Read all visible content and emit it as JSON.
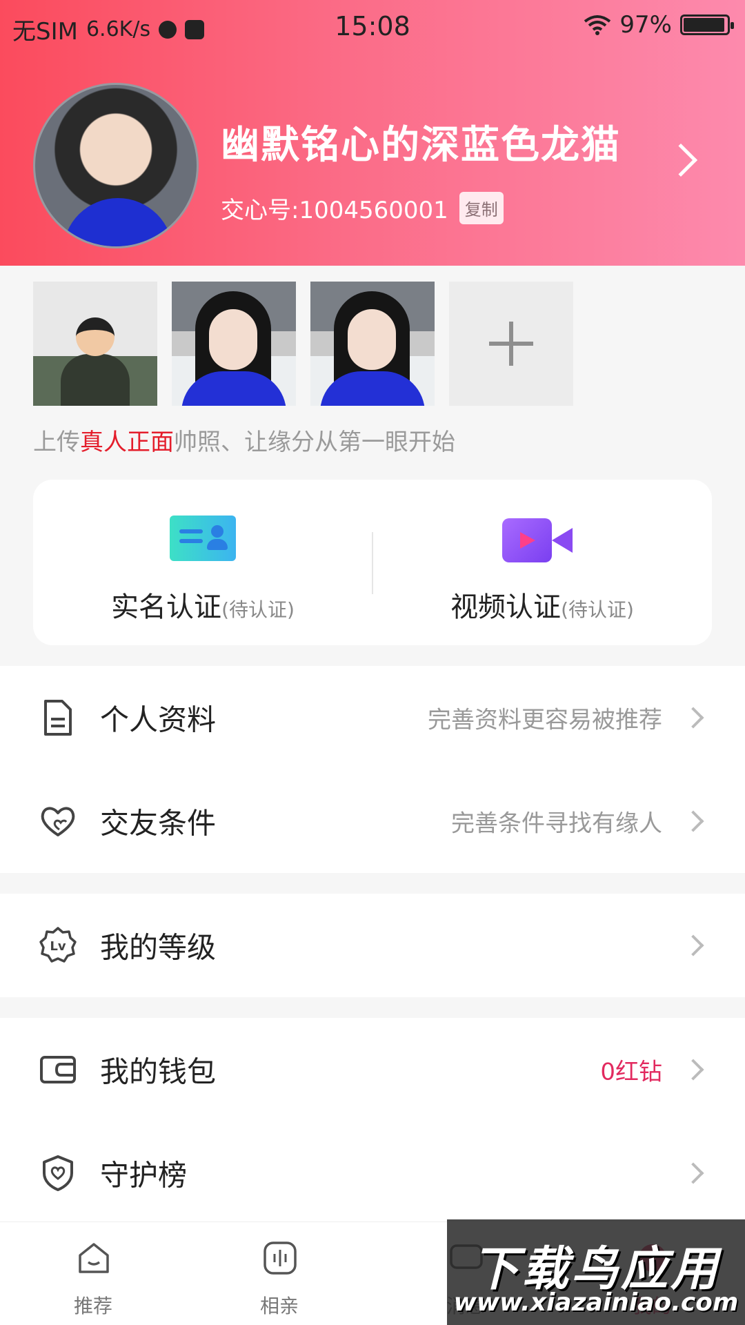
{
  "status_bar": {
    "carrier": "无SIM",
    "speed": "6.6K/s",
    "time": "15:08",
    "battery": "97%"
  },
  "profile": {
    "name": "幽默铭心的深蓝色龙猫",
    "id_text": "交心号:1004560001",
    "copy_label": "复制"
  },
  "photos": {
    "hint_pre": "上传",
    "hint_em": "真人正面",
    "hint_post": "帅照、让缘分从第一眼开始"
  },
  "verify": {
    "realname_label": "实名认证",
    "realname_status": "(待认证)",
    "video_label": "视频认证",
    "video_status": "(待认证)"
  },
  "menu": {
    "profile": {
      "label": "个人资料",
      "hint": "完善资料更容易被推荐"
    },
    "conditions": {
      "label": "交友条件",
      "hint": "完善条件寻找有缘人"
    },
    "level": {
      "label": "我的等级"
    },
    "wallet": {
      "label": "我的钱包",
      "hint": "0红钻"
    },
    "guard": {
      "label": "守护榜"
    }
  },
  "tabs": [
    {
      "label": "推荐"
    },
    {
      "label": "相亲"
    },
    {
      "label": "消息"
    },
    {
      "label": "我的"
    }
  ],
  "watermark": {
    "title": "下载鸟应用",
    "url": "www.xiazainiao.com"
  },
  "colors": {
    "header_start": "#fb4b5d",
    "header_end": "#fd8aad",
    "accent_red": "#e41d2b",
    "wallet_pink": "#e22a5f"
  },
  "icons": [
    "document-icon",
    "heart-icon",
    "level-badge-icon",
    "wallet-icon",
    "shield-icon",
    "home-icon",
    "voice-icon",
    "message-icon",
    "profile-icon",
    "plus-icon",
    "id-card-icon",
    "video-camera-icon",
    "chevron-right-icon"
  ]
}
